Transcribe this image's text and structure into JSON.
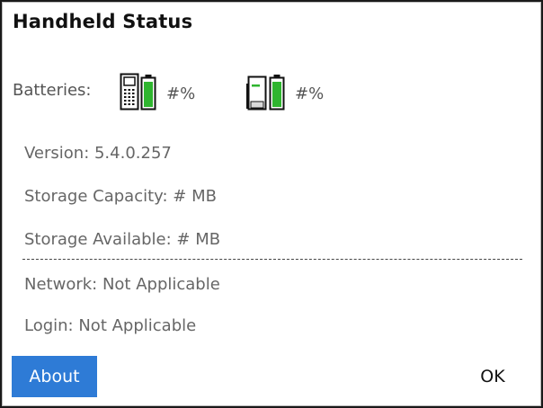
{
  "dialog": {
    "title": "Handheld Status"
  },
  "batteries": {
    "label": "Batteries:",
    "handheld": {
      "icon": "handheld-battery-icon",
      "percent_text": "#%",
      "fill_color": "#2fb52f"
    },
    "cradle": {
      "icon": "cradle-battery-icon",
      "percent_text": "#%",
      "fill_color": "#2fb52f"
    }
  },
  "info": {
    "version": "Version: 5.4.0.257",
    "storage_capacity": "Storage Capacity: # MB",
    "storage_available": "Storage Available: # MB",
    "network": "Network: Not Applicable",
    "login": "Login: Not Applicable"
  },
  "buttons": {
    "about_label": "About",
    "ok_label": "OK"
  },
  "colors": {
    "accent": "#2e7bd6",
    "battery_green": "#2fb52f"
  }
}
